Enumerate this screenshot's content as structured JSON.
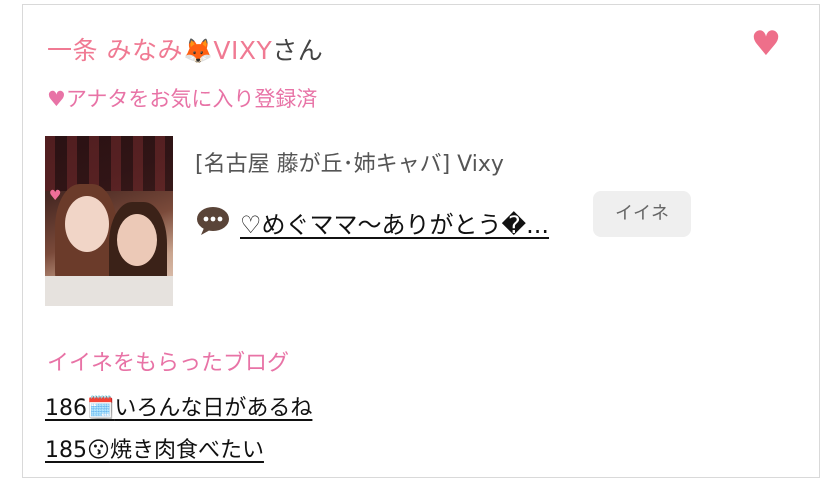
{
  "profile": {
    "name": "一条 みなみ",
    "name_emoji": "🦊",
    "name_suffix": "VIXY",
    "honorific": "さん",
    "favorite_status": "♥アナタをお気に入り登録済"
  },
  "favorite_icon": "heart-icon",
  "post": {
    "shop": "[名古屋 藤が丘･姉キャバ]  Vixy",
    "title": "♡めぐママ〜ありがとう�...",
    "comment_icon": "speech-bubble-icon",
    "like_button_label": "イイネ"
  },
  "liked_blogs": {
    "title": "イイネをもらったブログ",
    "items": [
      {
        "number": "186",
        "emoji": "🗓️",
        "text": "いろんな日があるね"
      },
      {
        "number": "185",
        "emoji": "😗",
        "text": "焼き肉食べたい"
      }
    ]
  },
  "colors": {
    "accent_pink": "#f07a93",
    "label_pink": "#e873a6",
    "button_bg": "#efefef"
  }
}
